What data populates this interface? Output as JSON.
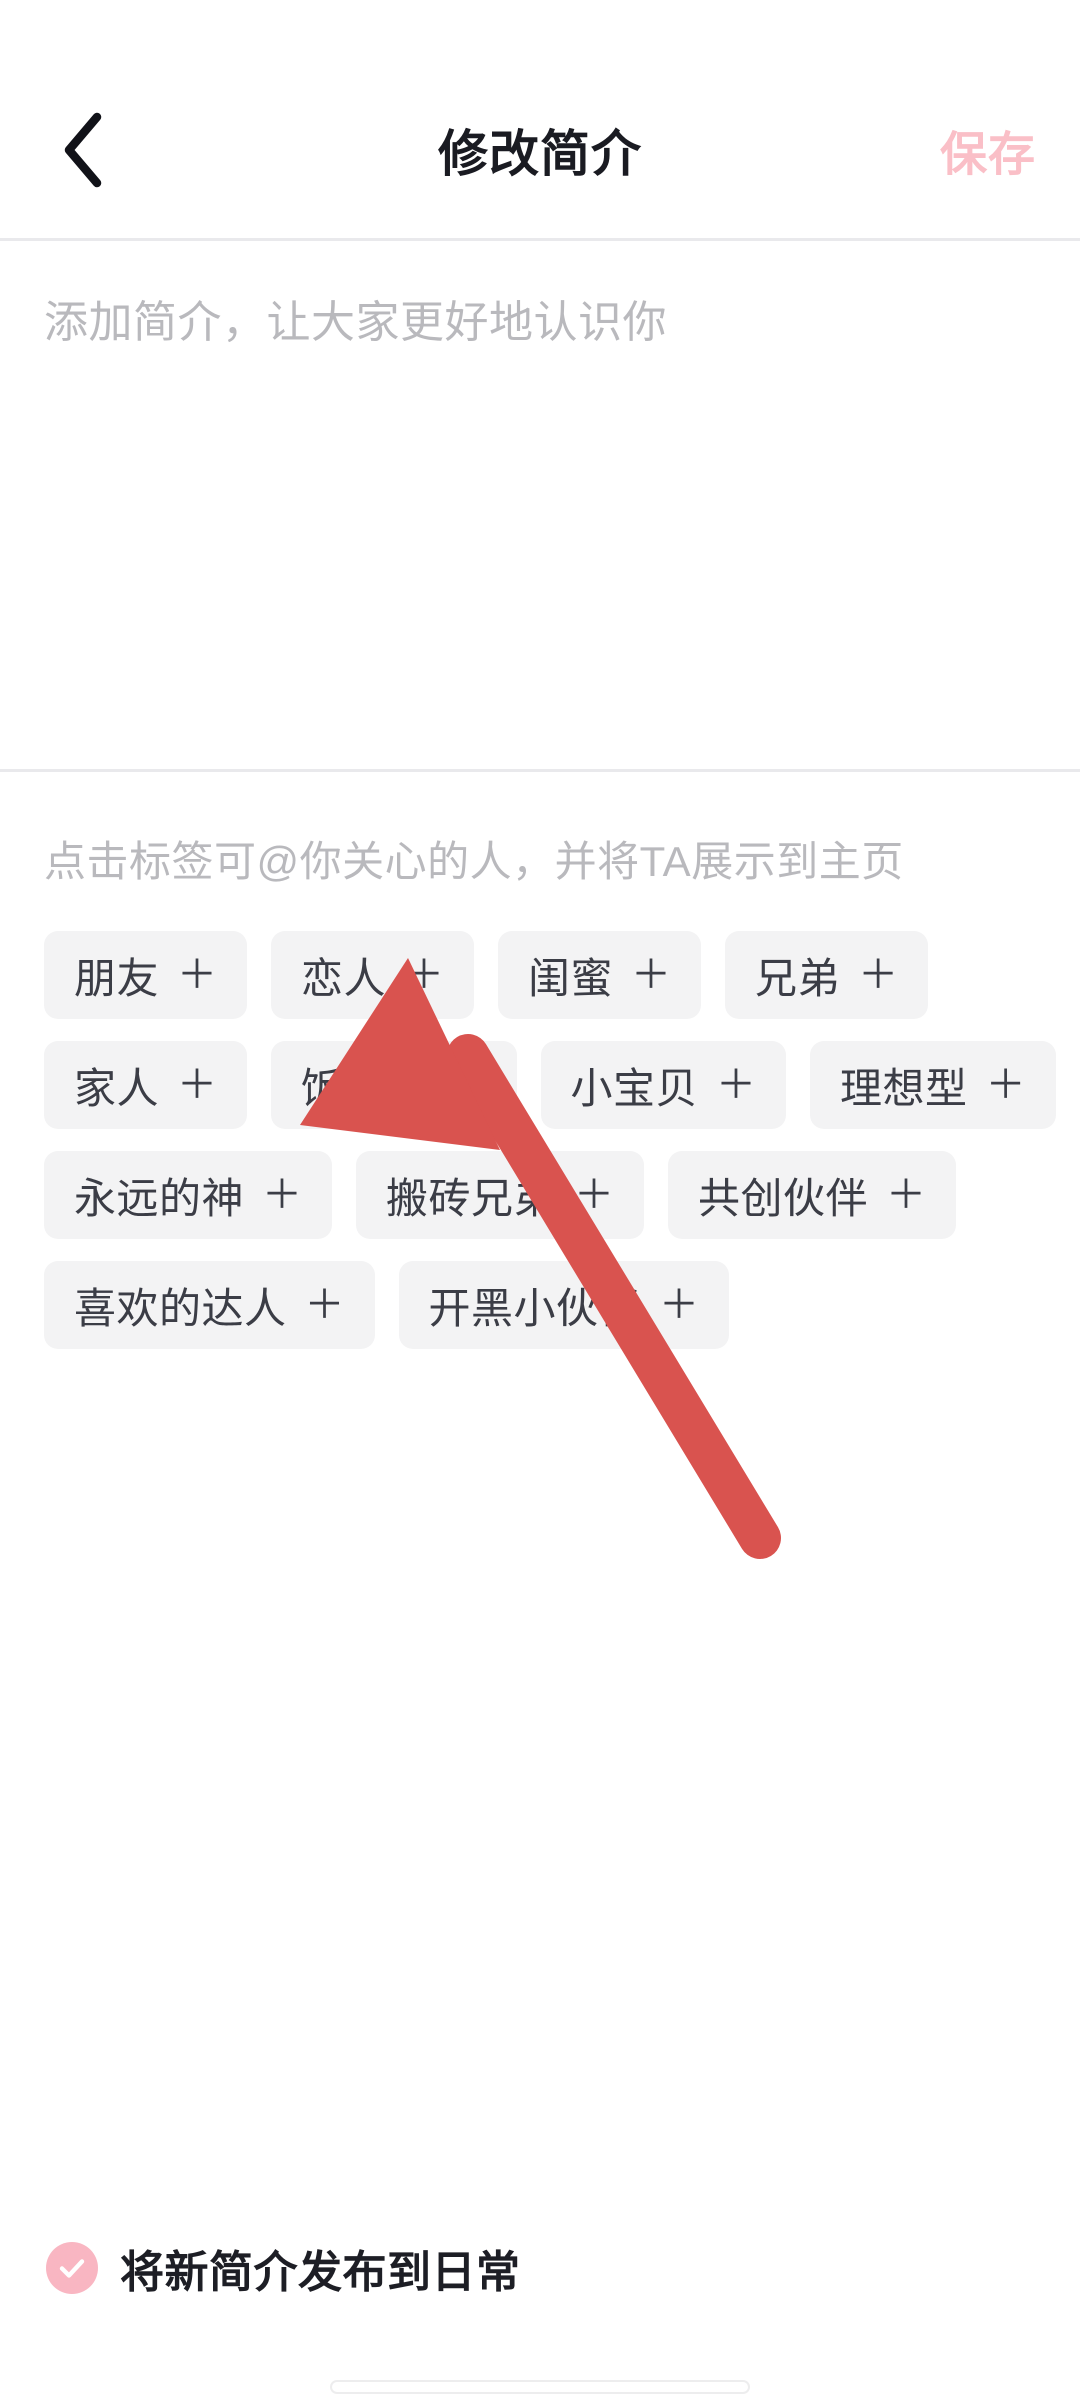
{
  "header": {
    "back_icon": "chevron-left-icon",
    "title": "修改简介",
    "save_label": "保存"
  },
  "bio": {
    "value": "",
    "placeholder": "添加简介，让大家更好地认识你"
  },
  "tags": {
    "hint": "点击标签可@你关心的人，并将TA展示到主页",
    "add_glyph": "＋",
    "rows": [
      [
        {
          "label": "朋友"
        },
        {
          "label": "恋人"
        },
        {
          "label": "闺蜜"
        },
        {
          "label": "兄弟"
        }
      ],
      [
        {
          "label": "家人"
        },
        {
          "label": "饭搭子"
        },
        {
          "label": "小宝贝"
        },
        {
          "label": "理想型"
        }
      ],
      [
        {
          "label": "永远的神"
        },
        {
          "label": "搬砖兄弟"
        },
        {
          "label": "共创伙伴"
        }
      ],
      [
        {
          "label": "喜欢的达人"
        },
        {
          "label": "开黑小伙伴"
        }
      ]
    ]
  },
  "publish": {
    "checked": true,
    "check_icon": "check-icon",
    "label": "将新简介发布到日常"
  },
  "annotation": {
    "type": "arrow",
    "color": "#d9534f",
    "points_at": "恋人"
  },
  "colors": {
    "accent_pink": "#f9b6c2",
    "save_disabled": "#fabfc7",
    "chip_bg": "#f3f3f4",
    "text_primary": "#1a1b22",
    "text_placeholder": "#b9b9bd",
    "divider": "#e9e9ec"
  }
}
